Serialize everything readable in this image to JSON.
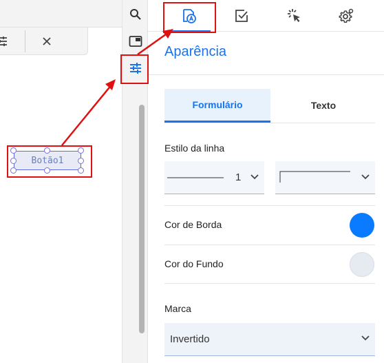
{
  "canvas": {
    "widget_text": "Botão1"
  },
  "panel": {
    "title": "Aparência",
    "tabs": [
      {
        "name": "appearance-tab",
        "icon": "appearance-icon",
        "active": true
      },
      {
        "name": "checklist-tab",
        "icon": "checkbox-icon",
        "active": false
      },
      {
        "name": "actions-tab",
        "icon": "click-icon",
        "active": false
      },
      {
        "name": "settings-tab",
        "icon": "gear-icon",
        "active": false
      }
    ],
    "subtabs": {
      "form": "Formulário",
      "text": "Texto"
    },
    "line_style": {
      "label": "Estilo da linha",
      "width_value": "1"
    },
    "border_color": {
      "label": "Cor de Borda",
      "value": "#0a7bff"
    },
    "background_color": {
      "label": "Cor do Fundo",
      "value": "#e6ebf2"
    },
    "brand": {
      "label": "Marca",
      "value": "Invertido"
    }
  },
  "colors": {
    "accent": "#1a73e8",
    "annotation": "#e01010"
  }
}
